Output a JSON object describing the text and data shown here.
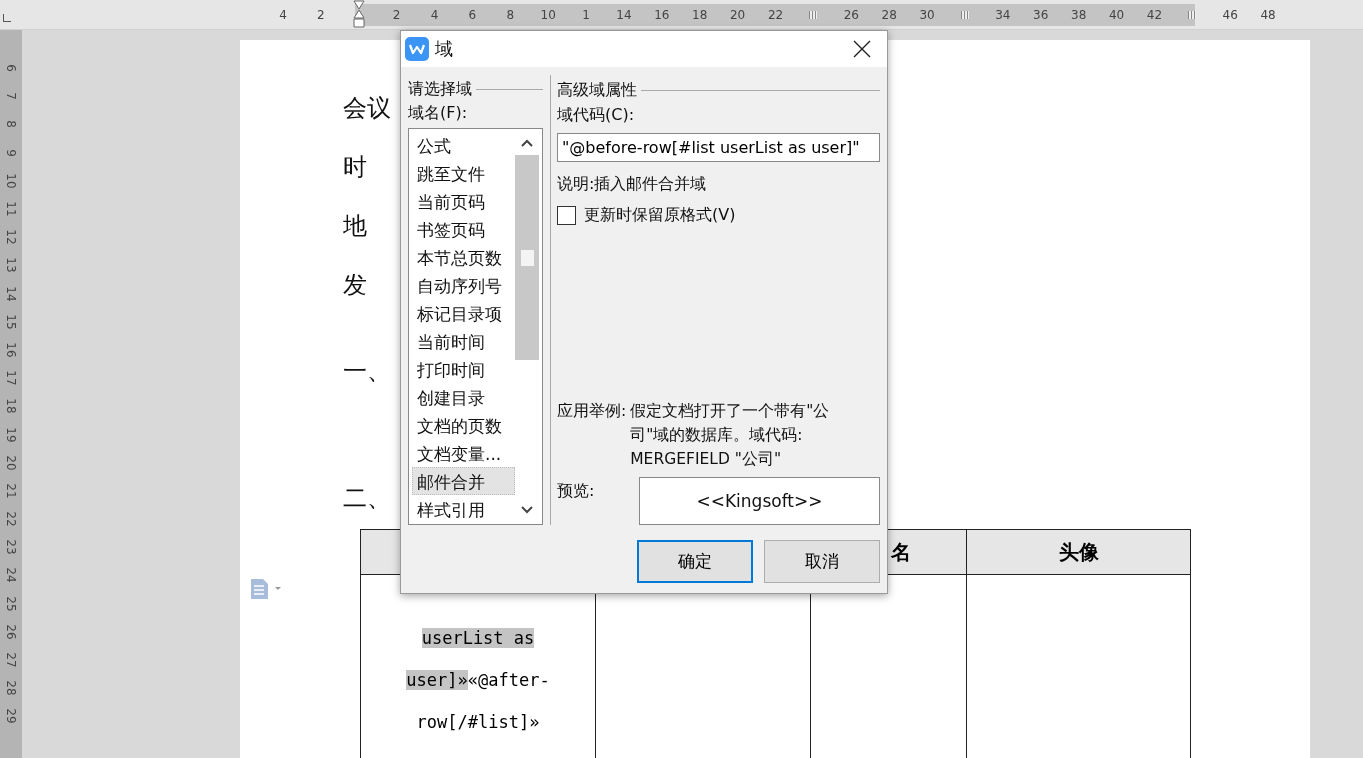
{
  "top_ruler": [
    {
      "kind": "label",
      "text": "4"
    },
    {
      "kind": "label",
      "text": "2"
    },
    {
      "kind": "indent"
    },
    {
      "kind": "label",
      "text": "2"
    },
    {
      "kind": "label",
      "text": "4"
    },
    {
      "kind": "label",
      "text": "6"
    },
    {
      "kind": "label",
      "text": "8"
    },
    {
      "kind": "label",
      "text": "10"
    },
    {
      "kind": "label",
      "text": "1"
    },
    {
      "kind": "label",
      "text": "14"
    },
    {
      "kind": "label",
      "text": "16"
    },
    {
      "kind": "label",
      "text": "18"
    },
    {
      "kind": "label",
      "text": "20"
    },
    {
      "kind": "label",
      "text": "22"
    },
    {
      "kind": "marker"
    },
    {
      "kind": "label",
      "text": "26"
    },
    {
      "kind": "label",
      "text": "28"
    },
    {
      "kind": "label",
      "text": "30"
    },
    {
      "kind": "marker"
    },
    {
      "kind": "label",
      "text": "34"
    },
    {
      "kind": "label",
      "text": "36"
    },
    {
      "kind": "label",
      "text": "38"
    },
    {
      "kind": "label",
      "text": "40"
    },
    {
      "kind": "label",
      "text": "42"
    },
    {
      "kind": "marker"
    },
    {
      "kind": "label",
      "text": "46"
    },
    {
      "kind": "label",
      "text": "48"
    }
  ],
  "left_ruler": [
    "6",
    "7",
    "8",
    "9",
    "10",
    "11",
    "12",
    "13",
    "14",
    "15",
    "16",
    "17",
    "18",
    "19",
    "20",
    "21",
    "22",
    "23",
    "24",
    "25",
    "26",
    "27",
    "28",
    "29"
  ],
  "document": {
    "lines": [
      {
        "kind": "field",
        "text": "会议"
      },
      {
        "kind": "field",
        "text": "时"
      },
      {
        "kind": "field",
        "text": "地"
      },
      {
        "kind": "field",
        "text": "发"
      },
      {
        "kind": "section",
        "text": "一、"
      },
      {
        "kind": "section",
        "text": "二、"
      }
    ],
    "table": {
      "headers": [
        "名",
        "头像"
      ],
      "first_cell": [
        {
          "text": "userList as user]»",
          "highlighted": true
        },
        {
          "text": "«@after-row[/#list]»",
          "highlighted": false
        }
      ]
    }
  },
  "dialog": {
    "title": "域",
    "left_group": "请选择域",
    "list_label": "域名(F):",
    "items": [
      {
        "label": "公式",
        "selected": false
      },
      {
        "label": "跳至文件",
        "selected": false
      },
      {
        "label": "当前页码",
        "selected": false
      },
      {
        "label": "书签页码",
        "selected": false
      },
      {
        "label": "本节总页数",
        "selected": false
      },
      {
        "label": "自动序列号",
        "selected": false
      },
      {
        "label": "标记目录项",
        "selected": false
      },
      {
        "label": "当前时间",
        "selected": false
      },
      {
        "label": "打印时间",
        "selected": false
      },
      {
        "label": "创建目录",
        "selected": false
      },
      {
        "label": "文档的页数",
        "selected": false
      },
      {
        "label": "文档变量...",
        "selected": false
      },
      {
        "label": "邮件合并",
        "selected": true
      },
      {
        "label": "样式引用",
        "selected": false
      }
    ],
    "right_group": "高级域属性",
    "code_label": "域代码(C):",
    "code_value": "\"@before-row[#list userList as user]\"",
    "description": "说明:插入邮件合并域",
    "keep_format": {
      "label": "更新时保留原格式(V)",
      "checked": false
    },
    "example_label": "应用举例:",
    "example_text": "假定文档打开了一个带有\"公司\"域的数据库。域代码: MERGEFIELD \"公司\"",
    "preview_label": "预览:",
    "preview_value": "<<Kingsoft>>",
    "buttons": [
      {
        "label": "确定",
        "default": true
      },
      {
        "label": "取消",
        "default": false
      }
    ]
  }
}
